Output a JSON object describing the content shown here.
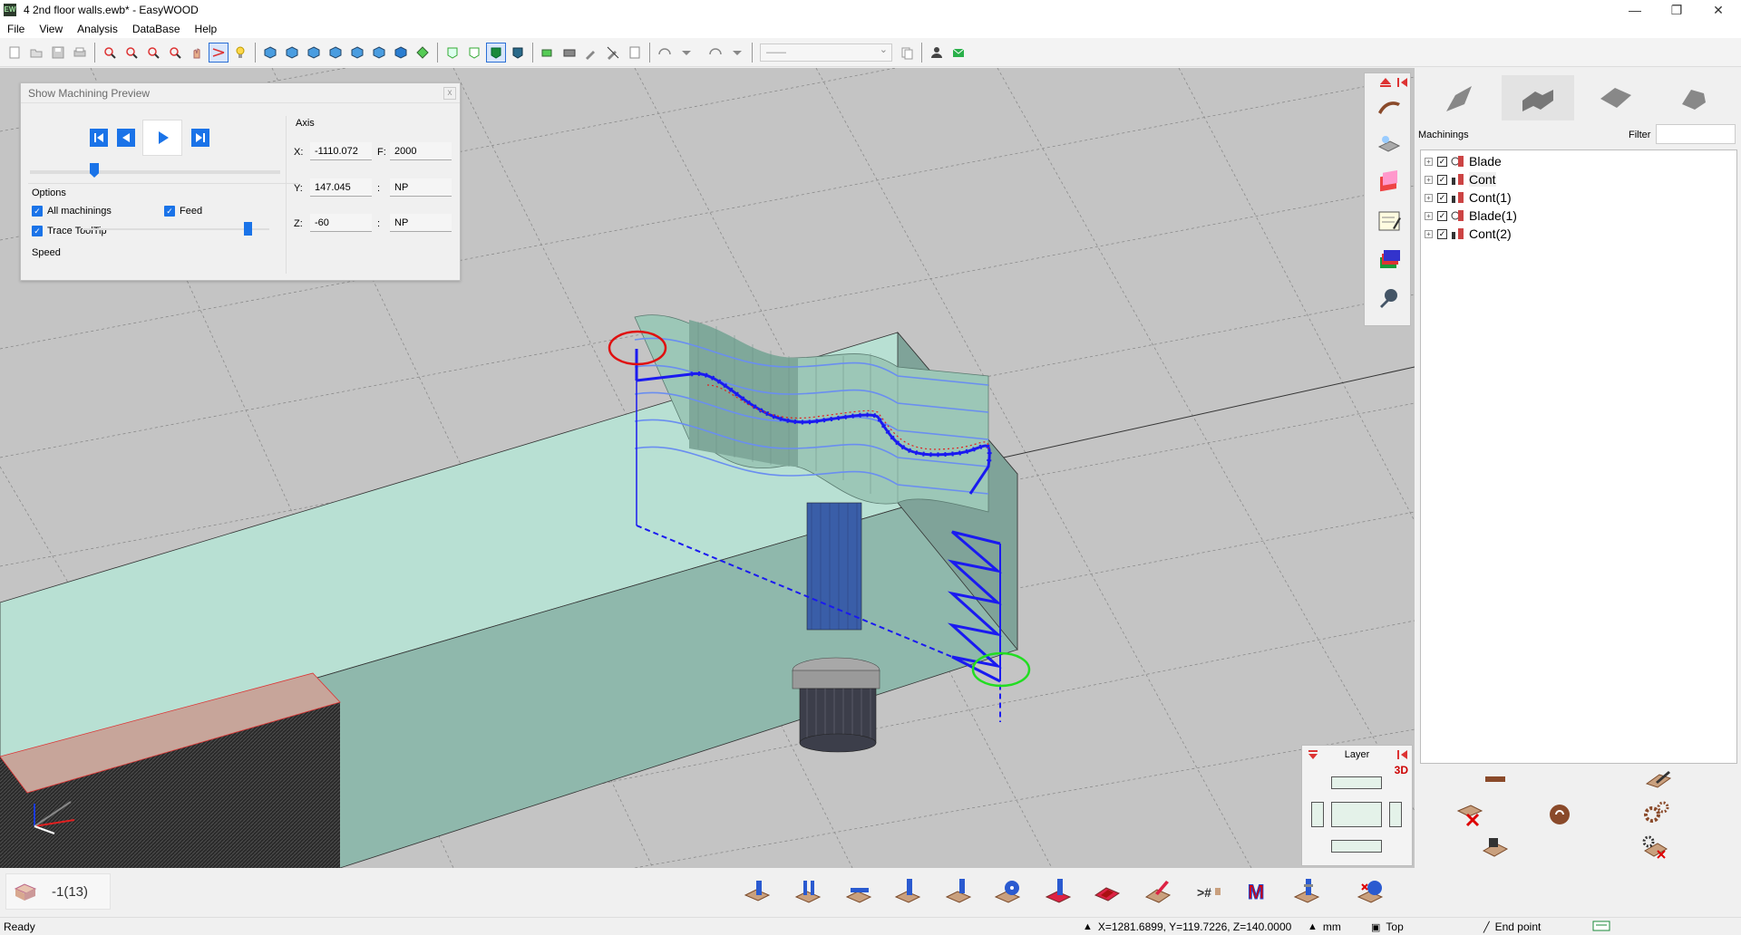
{
  "window": {
    "app_icon_text": "EW",
    "title": "4 2nd floor walls.ewb* - EasyWOOD",
    "minimize": "—",
    "maximize": "❐",
    "close": "✕"
  },
  "menu": {
    "items": [
      "File",
      "View",
      "Analysis",
      "DataBase",
      "Help"
    ]
  },
  "toolbar": {
    "combo_value": "——"
  },
  "preview_dialog": {
    "title": "Show Machining Preview",
    "close": "x",
    "options_label": "Options",
    "all_machinings_label": "All machinings",
    "all_machinings_checked": true,
    "feed_label": "Feed",
    "feed_checked": true,
    "trace_tooltip_label": "Trace ToolTip",
    "trace_tooltip_checked": true,
    "speed_label": "Speed",
    "axis_label": "Axis",
    "x_label": "X:",
    "x_value": "-1110.072",
    "f_label": "F:",
    "f_value": "2000",
    "y_label": "Y:",
    "y_value": "147.045",
    "y_extra_label": ":",
    "y_extra_value": "NP",
    "z_label": "Z:",
    "z_value": "-60",
    "z_extra_label": ":",
    "z_extra_value": "NP"
  },
  "layer_panel": {
    "title": "Layer",
    "mode": "3D"
  },
  "right_panel": {
    "machinings_label": "Machinings",
    "filter_label": "Filter",
    "filter_value": "",
    "tree": [
      {
        "label": "Blade",
        "checked": true,
        "type": "blade",
        "selected": false
      },
      {
        "label": "Cont",
        "checked": true,
        "type": "contour",
        "selected": true
      },
      {
        "label": "Cont(1)",
        "checked": true,
        "type": "contour",
        "selected": false
      },
      {
        "label": "Blade(1)",
        "checked": true,
        "type": "blade",
        "selected": false
      },
      {
        "label": "Cont(2)",
        "checked": true,
        "type": "contour",
        "selected": false
      }
    ]
  },
  "bottom_bar": {
    "counter": "-1(13)"
  },
  "status_bar": {
    "ready": "Ready",
    "coords": "X=1281.6899, Y=119.7226, Z=140.0000",
    "unit": "mm",
    "view": "Top",
    "snap": "End point"
  },
  "colors": {
    "toolpath": "#1a1af0",
    "start_marker": "#e01010",
    "end_marker": "#22dd22",
    "stock_fill": "#b5ddd0",
    "accent": "#1a73e8"
  }
}
